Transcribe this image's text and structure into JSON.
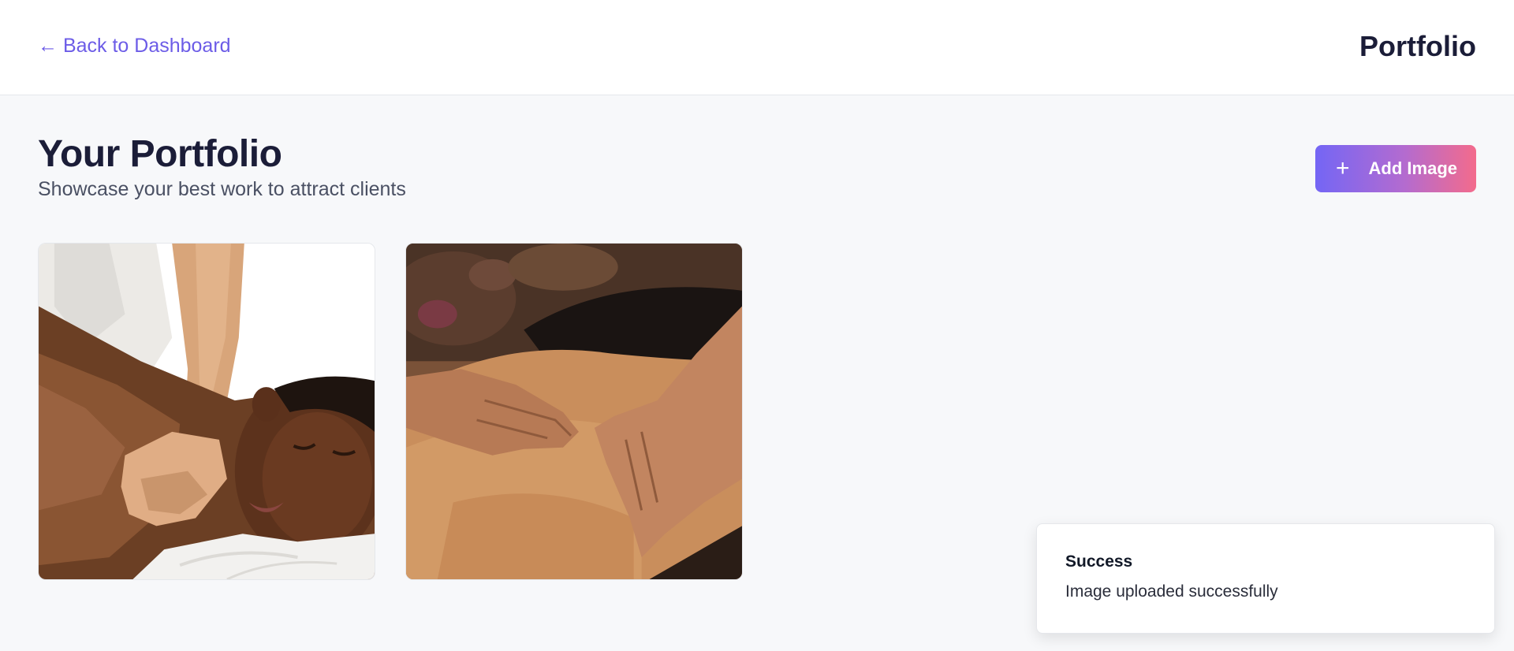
{
  "header": {
    "back_link": "← Back to Dashboard",
    "title": "Portfolio"
  },
  "main": {
    "heading": "Your Portfolio",
    "subtitle": "Showcase your best work to attract clients",
    "add_button": {
      "icon": "plus-icon",
      "label": "Add Image"
    },
    "gallery": [
      {
        "kind": "photo",
        "subject": "shoulder massage"
      },
      {
        "kind": "photo",
        "subject": "back massage"
      }
    ]
  },
  "toast": {
    "title": "Success",
    "message": "Image uploaded successfully"
  },
  "colors": {
    "accent": "#6c5ce7",
    "gradient_start": "#7466f5",
    "gradient_end": "#f36b8c",
    "background": "#f7f8fa",
    "text_dark": "#1b1d38"
  }
}
